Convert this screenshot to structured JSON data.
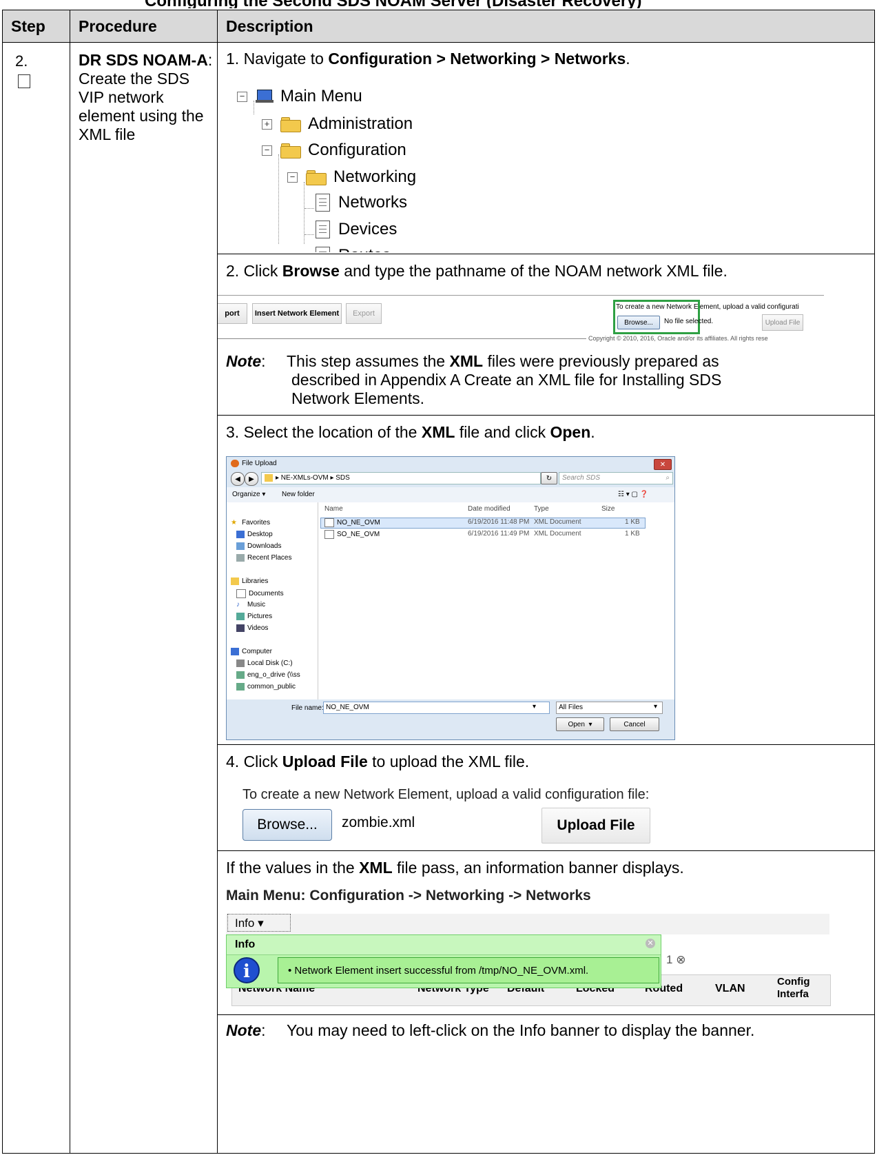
{
  "partial_heading": "Configuring the Second SDS NOAM Server (Disaster Recovery)",
  "table": {
    "headers": {
      "step": "Step",
      "procedure": "Procedure",
      "description": "Description"
    },
    "step_number": "2.",
    "procedure_title": "DR SDS NOAM-A",
    "procedure_rest": ": Create the SDS VIP network element using the XML file"
  },
  "desc": {
    "s1_prefix": "1.   Navigate to ",
    "s1_bold": "Configuration > Networking > Networks",
    "s1_suffix": ".",
    "tree": {
      "main_menu": "Main Menu",
      "administration": "Administration",
      "configuration": "Configuration",
      "networking": "Networking",
      "networks": "Networks",
      "devices": "Devices",
      "routes": "Routes"
    },
    "s2_prefix": "2.   Click ",
    "s2_bold": "Browse",
    "s2_suffix": " and type the pathname of the NOAM network XML file.",
    "toolbar": {
      "export_partial": "port",
      "insert_button": "Insert Network Element",
      "export_button": "Export",
      "create_text": "To create a new Network Element, upload a valid configurati",
      "browse_button": "Browse...",
      "no_file": "No file selected.",
      "upload_button": "Upload File",
      "copyright": "Copyright © 2010, 2016, Oracle and/or its affiliates. All rights rese"
    },
    "note1_label": "Note",
    "note1_a": "This step assumes the ",
    "note1_bold": "XML",
    "note1_b": " files were previously prepared as",
    "note1_line2": "described in Appendix A Create an XML file for Installing SDS",
    "note1_line3": "Network Elements.",
    "s3_prefix": "3.   Select the location of the ",
    "s3_bold1": "XML",
    "s3_mid": " file and click ",
    "s3_bold2": "Open",
    "s3_suffix": ".",
    "dialog": {
      "title": "File Upload",
      "path": "▸ NE-XMLs-OVM ▸ SDS",
      "search_placeholder": "Search SDS",
      "organize": "Organize ▾",
      "new_folder": "New folder",
      "columns": [
        "Name",
        "Date modified",
        "Type",
        "Size"
      ],
      "files": [
        {
          "name": "NO_NE_OVM",
          "date": "6/19/2016 11:48 PM",
          "type": "XML Document",
          "size": "1 KB"
        },
        {
          "name": "SO_NE_OVM",
          "date": "6/19/2016 11:49 PM",
          "type": "XML Document",
          "size": "1 KB"
        }
      ],
      "nav": [
        "Favorites",
        "Desktop",
        "Downloads",
        "Recent Places",
        "Libraries",
        "Documents",
        "Music",
        "Pictures",
        "Videos",
        "Computer",
        "Local Disk (C:)",
        "eng_o_drive (\\\\ss",
        "common_public"
      ],
      "file_name_label": "File name:",
      "file_name_value": "NO_NE_OVM",
      "filter": "All Files",
      "open": "Open",
      "cancel": "Cancel"
    },
    "s4_prefix": "4.   Click ",
    "s4_bold": "Upload File",
    "s4_suffix": " to upload the XML file.",
    "upload": {
      "create_text": "To create a new Network Element, upload a valid configuration file:",
      "browse": "Browse...",
      "file": "zombie.xml",
      "upload_button": "Upload File"
    },
    "pass_prefix": "If the values in the ",
    "pass_bold": "XML",
    "pass_suffix": " file pass, an information banner displays.",
    "banner": {
      "menu_title": "Main Menu: Configuration -> Networking -> Networks",
      "info_tab": "Info",
      "info_head": "Info",
      "message": "• Network Element insert successful from /tmp/NO_NE_OVM.xml.",
      "partial_tab": "1",
      "cols": [
        "Network Name",
        "Network Type",
        "Default",
        "Locked",
        "Routed",
        "VLAN",
        "Config",
        "Interfa"
      ]
    },
    "note2_label": "Note",
    "note2_text": "You may need to left-click on the Info banner to display the banner."
  }
}
